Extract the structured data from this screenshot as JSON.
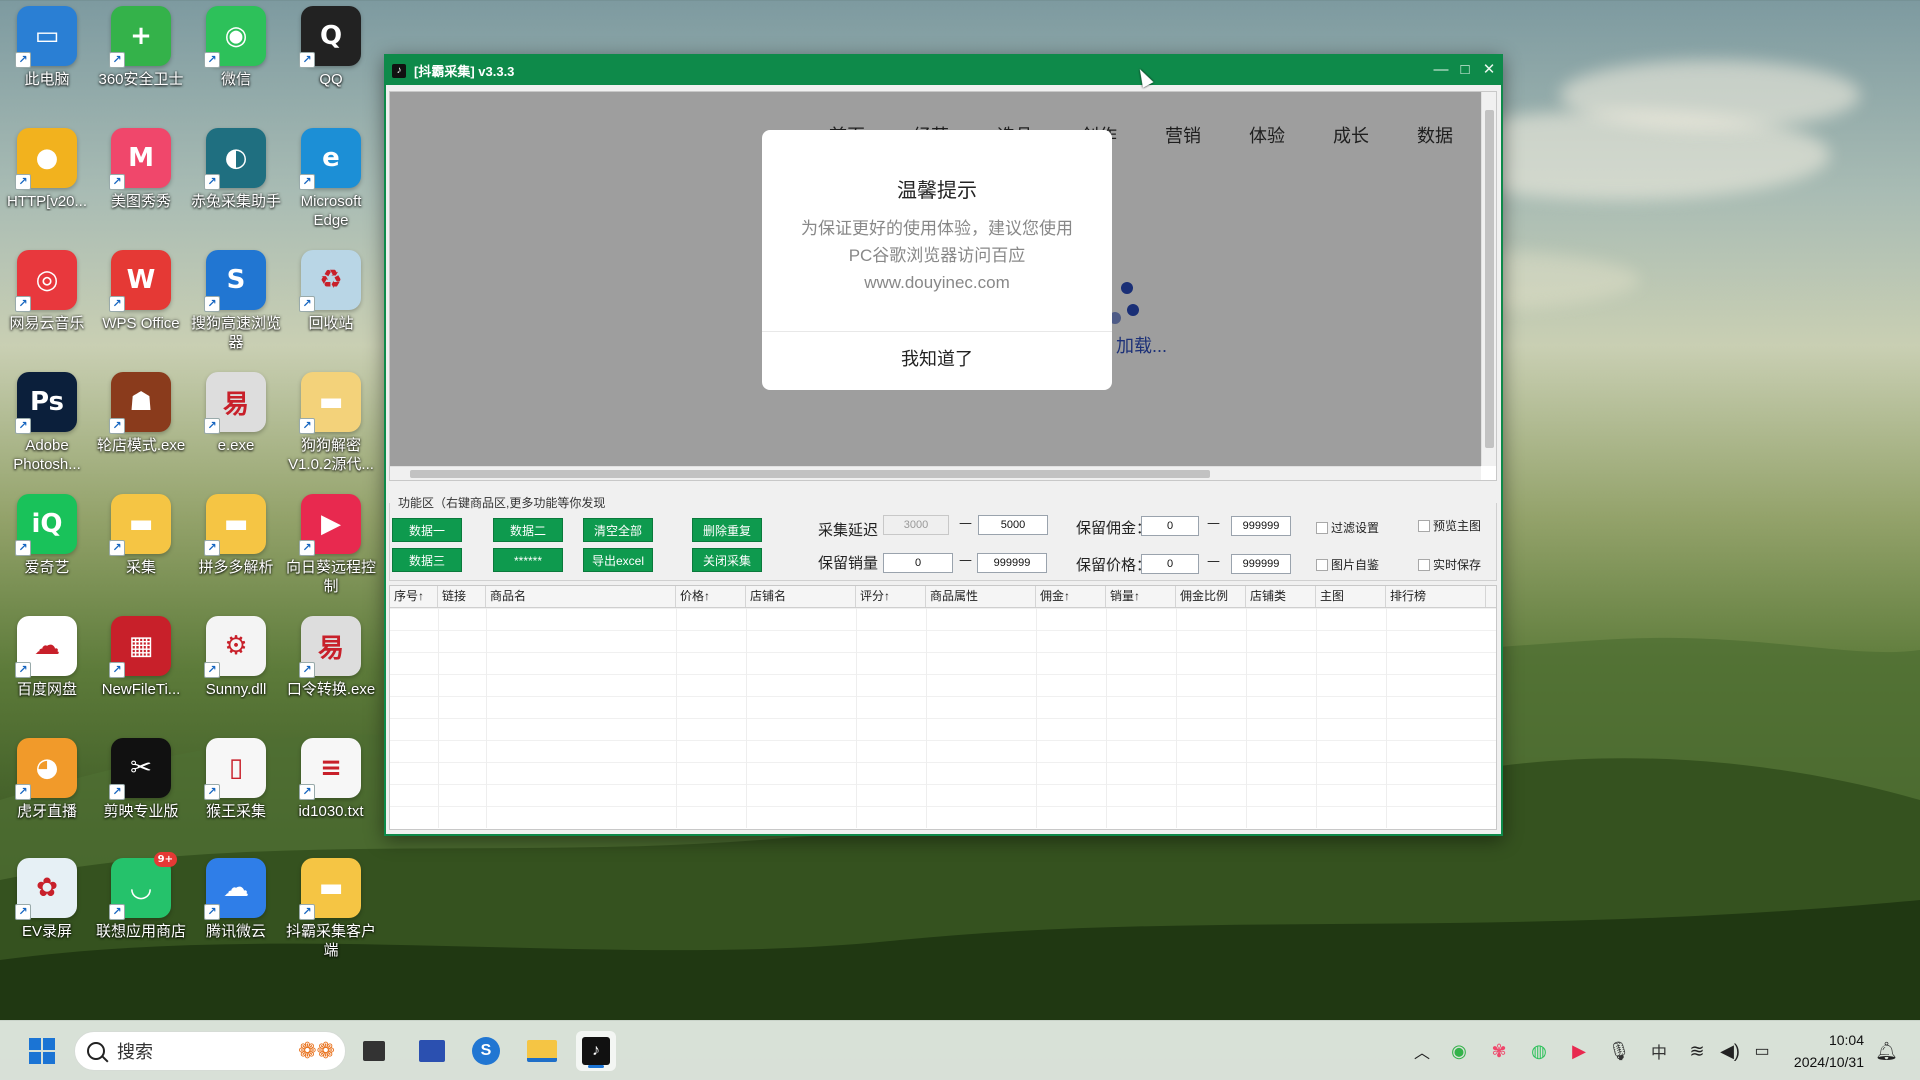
{
  "desktop": {
    "icons": [
      {
        "label": "此电脑",
        "color": "#2a7fd4",
        "glyph": "▭",
        "icon": "monitor-icon"
      },
      {
        "label": "360安全卫士",
        "color": "#34b24a",
        "glyph": "+",
        "icon": "360-shield-icon"
      },
      {
        "label": "微信",
        "color": "#2dc15a",
        "glyph": "◉",
        "icon": "wechat-icon"
      },
      {
        "label": "QQ",
        "color": "#222222",
        "glyph": "Q",
        "icon": "qq-penguin-icon"
      },
      {
        "label": "HTTP[v20...",
        "color": "#f2b21e",
        "glyph": "●",
        "icon": "lightbulb-icon"
      },
      {
        "label": "美图秀秀",
        "color": "#f0476b",
        "glyph": "M",
        "icon": "meitu-icon"
      },
      {
        "label": "赤兔采集助手",
        "color": "#1f6f80",
        "glyph": "◐",
        "icon": "horse-icon"
      },
      {
        "label": "Microsoft Edge",
        "color": "#1c8fd6",
        "glyph": "e",
        "icon": "edge-icon"
      },
      {
        "label": "网易云音乐",
        "color": "#e8383d",
        "glyph": "◎",
        "icon": "netease-music-icon"
      },
      {
        "label": "WPS Office",
        "color": "#e53935",
        "glyph": "W",
        "icon": "wps-icon"
      },
      {
        "label": "搜狗高速浏览器",
        "color": "#2176d2",
        "glyph": "S",
        "icon": "sogou-browser-icon"
      },
      {
        "label": "回收站",
        "color": "#b9d6e6",
        "glyph": "♻",
        "icon": "recycle-bin-icon"
      },
      {
        "label": "Adobe Photosh...",
        "color": "#0b1f3b",
        "glyph": "Ps",
        "icon": "photoshop-icon"
      },
      {
        "label": "轮店模式.exe",
        "color": "#8a3b1c",
        "glyph": "☗",
        "icon": "gorilla-icon"
      },
      {
        "label": "e.exe",
        "color": "#dddddd",
        "glyph": "易",
        "icon": "e-language-icon"
      },
      {
        "label": "狗狗解密 V1.0.2源代...",
        "color": "#f3d27a",
        "glyph": "▬",
        "icon": "folder-icon"
      },
      {
        "label": "爱奇艺",
        "color": "#19c25a",
        "glyph": "iQ",
        "icon": "iqiyi-icon"
      },
      {
        "label": "采集",
        "color": "#f5c544",
        "glyph": "▬",
        "icon": "folder-icon"
      },
      {
        "label": "拼多多解析",
        "color": "#f5c544",
        "glyph": "▬",
        "icon": "folder-icon"
      },
      {
        "label": "向日葵远程控制",
        "color": "#e8294f",
        "glyph": "▶",
        "icon": "sunflower-remote-icon"
      },
      {
        "label": "百度网盘",
        "color": "#ffffff",
        "glyph": "☁",
        "icon": "baidu-netdisk-icon"
      },
      {
        "label": "NewFileTi...",
        "color": "#c8202a",
        "glyph": "▦",
        "icon": "newfiletime-icon"
      },
      {
        "label": "Sunny.dll",
        "color": "#f4f4f4",
        "glyph": "⚙",
        "icon": "dll-file-icon"
      },
      {
        "label": "口令转换.exe",
        "color": "#dddddd",
        "glyph": "易",
        "icon": "e-language-icon"
      },
      {
        "label": "虎牙直播",
        "color": "#f19a2a",
        "glyph": "◕",
        "icon": "huya-icon"
      },
      {
        "label": "剪映专业版",
        "color": "#111111",
        "glyph": "✂",
        "icon": "capcut-icon"
      },
      {
        "label": "猴王采集",
        "color": "#f7f7f7",
        "glyph": "▯",
        "icon": "file-icon"
      },
      {
        "label": "id1030.txt",
        "color": "#f7f7f7",
        "glyph": "≡",
        "icon": "text-file-icon"
      },
      {
        "label": "EV录屏",
        "color": "#e6f0f5",
        "glyph": "✿",
        "icon": "ev-recorder-icon"
      },
      {
        "label": "联想应用商店",
        "color": "#25c26b",
        "glyph": "◡",
        "icon": "lenovo-store-icon",
        "badge": "9+"
      },
      {
        "label": "腾讯微云",
        "color": "#2f7ee8",
        "glyph": "☁",
        "icon": "weiyun-icon"
      },
      {
        "label": "抖霸采集客户端",
        "color": "#f5c544",
        "glyph": "▬",
        "icon": "folder-icon"
      }
    ]
  },
  "window": {
    "title": "[抖霸采集] v3.3.3",
    "minimize": "—",
    "maximize": "□",
    "close": "✕"
  },
  "browser": {
    "nav": [
      "首页",
      "经营",
      "选品",
      "创作",
      "营销",
      "体验",
      "成长",
      "数据"
    ],
    "loading_text": "加载...",
    "dialog": {
      "title": "温馨提示",
      "line1": "为保证更好的使用体验，建议您使用",
      "line2": "PC谷歌浏览器访问百应",
      "line3": "www.douyinec.com",
      "button": "我知道了"
    }
  },
  "functions": {
    "section_label": "功能区（右键商品区,更多功能等你发现",
    "buttons": {
      "data1": "数据一",
      "data2": "数据二",
      "clear_all": "清空全部",
      "delete_dup": "删除重复",
      "data3": "数据三",
      "stars": "******",
      "export_excel": "导出excel",
      "close_collect": "关闭采集"
    },
    "delay_label": "采集延迟",
    "delay_min": "3000",
    "delay_max": "5000",
    "sales_label": "保留销量",
    "sales_min": "0",
    "sales_max": "999999",
    "commission_label": "保留佣金：",
    "commission_min": "0",
    "commission_max": "999999",
    "price_label": "保留价格：",
    "price_min": "0",
    "price_max": "999999",
    "dash": "—",
    "checks": {
      "filter": "过滤设置",
      "preview": "预览主图",
      "image_self": "图片自鉴",
      "autosave": "实时保存"
    }
  },
  "table": {
    "columns": [
      "序号↑",
      "链接",
      "商品名",
      "价格↑",
      "店铺名",
      "评分↑",
      "商品属性",
      "佣金↑",
      "销量↑",
      "佣金比例",
      "店铺类",
      "主图",
      "排行榜"
    ]
  },
  "taskbar": {
    "search_placeholder": "搜索",
    "time": "10:04",
    "date": "2024/10/31",
    "ime": "中",
    "accent": "#1b74d4"
  }
}
